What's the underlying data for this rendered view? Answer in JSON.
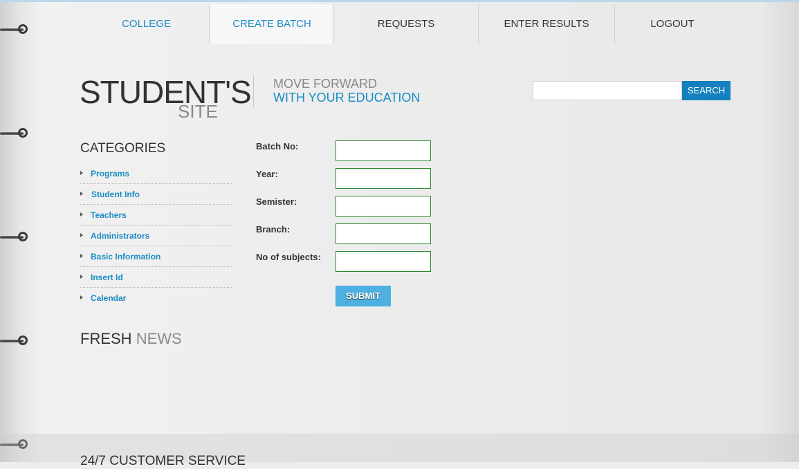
{
  "nav": {
    "items": [
      {
        "label": "COLLEGE"
      },
      {
        "label": "CREATE BATCH"
      },
      {
        "label": "REQUESTS"
      },
      {
        "label": "ENTER RESULTS"
      },
      {
        "label": "LOGOUT"
      }
    ]
  },
  "logo": {
    "main": "STUDENT'S",
    "sub": "SITE",
    "tagline_line1": "MOVE FORWARD",
    "tagline_line2": "WITH YOUR EDUCATION"
  },
  "search": {
    "value": "",
    "placeholder": "",
    "button_label": "SEARCH"
  },
  "categories": {
    "title": "CATEGORIES",
    "items": [
      {
        "label": "Programs"
      },
      {
        "label": "Student Info"
      },
      {
        "label": "Teachers"
      },
      {
        "label": "Administrators"
      },
      {
        "label": "Basic Information"
      },
      {
        "label": "Insert Id"
      },
      {
        "label": "Calendar"
      }
    ]
  },
  "news": {
    "title_part1": "FRESH",
    "title_part2": "NEWS"
  },
  "form": {
    "fields": [
      {
        "label": "Batch No:",
        "value": ""
      },
      {
        "label": "Year:",
        "value": ""
      },
      {
        "label": "Semister:",
        "value": ""
      },
      {
        "label": "Branch:",
        "value": ""
      },
      {
        "label": "No of subjects:",
        "value": ""
      }
    ],
    "submit_label": "SUBMIT"
  },
  "footer": {
    "text": "24/7 CUSTOMER SERVICE"
  },
  "colors": {
    "accent": "#1a8cc4",
    "search_button": "#1580be",
    "submit_button": "#4cb0e0",
    "input_border": "#2f8a2f"
  }
}
